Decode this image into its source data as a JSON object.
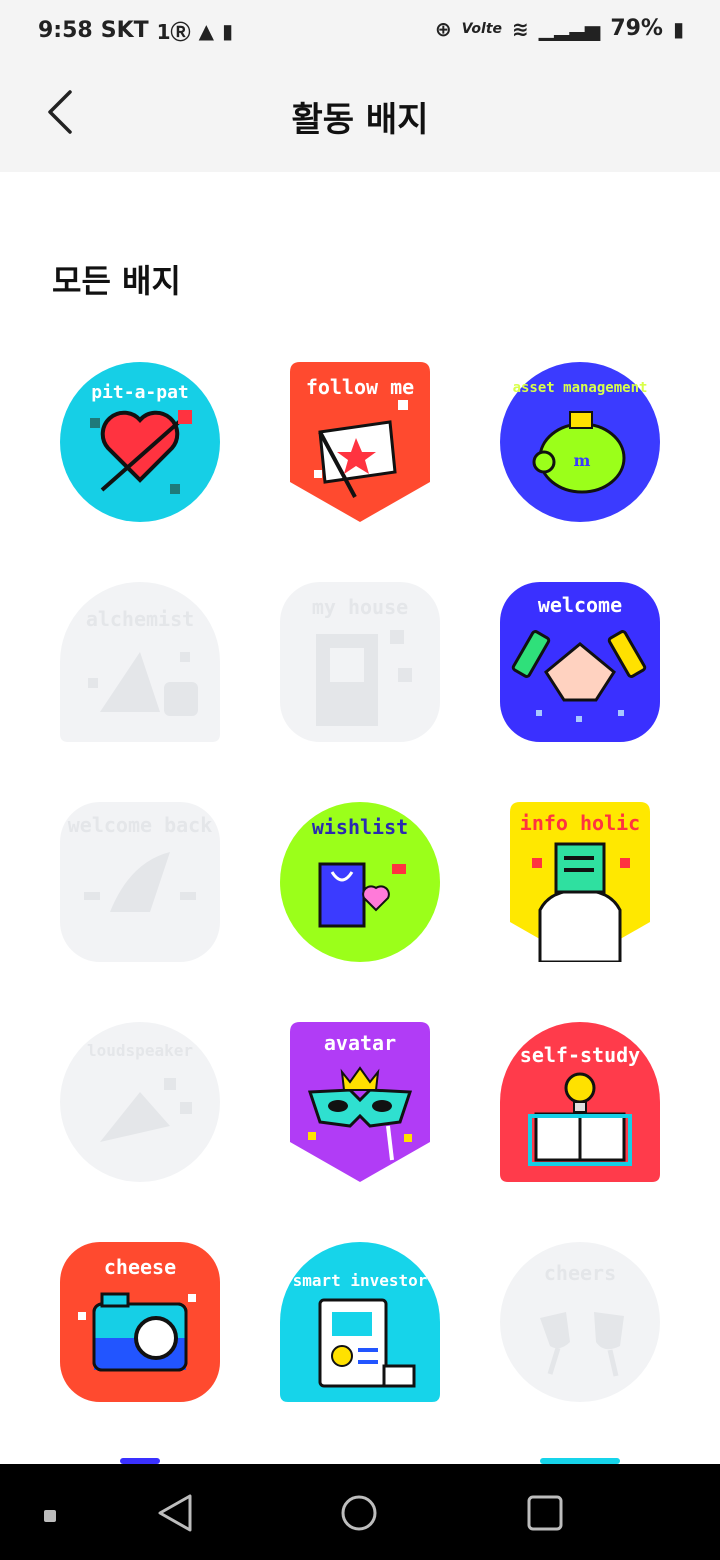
{
  "status_bar": {
    "time": "9:58",
    "carrier": "SKT",
    "network": "Volte",
    "battery": "79%"
  },
  "header": {
    "title": "활동 배지"
  },
  "section": {
    "title": "모든 배지"
  },
  "badges": [
    {
      "label": "pit-a-pat",
      "shape": "circle",
      "color": "#16cfe6",
      "unlocked": true
    },
    {
      "label": "follow me",
      "shape": "shield",
      "color": "#ff4a2f",
      "unlocked": true
    },
    {
      "label": "asset management",
      "shape": "circle",
      "color": "#3b3bff",
      "unlocked": true
    },
    {
      "label": "alchemist",
      "shape": "arch",
      "color": "#f2f3f5",
      "unlocked": false
    },
    {
      "label": "my house",
      "shape": "rounded",
      "color": "#f2f3f5",
      "unlocked": false
    },
    {
      "label": "welcome",
      "shape": "rounded",
      "color": "#3a30ff",
      "unlocked": true
    },
    {
      "label": "welcome back",
      "shape": "rounded",
      "color": "#f2f3f5",
      "unlocked": false
    },
    {
      "label": "wishlist",
      "shape": "circle",
      "color": "#9bff1a",
      "unlocked": true
    },
    {
      "label": "info holic",
      "shape": "shield",
      "color": "#ffe800",
      "unlocked": true
    },
    {
      "label": "loudspeaker",
      "shape": "circle",
      "color": "#f2f3f5",
      "unlocked": false
    },
    {
      "label": "avatar",
      "shape": "shield",
      "color": "#b13cf6",
      "unlocked": true
    },
    {
      "label": "self-study",
      "shape": "arch",
      "color": "#ff3b4b",
      "unlocked": true
    },
    {
      "label": "cheese",
      "shape": "rounded",
      "color": "#ff4a2f",
      "unlocked": true
    },
    {
      "label": "smart investor",
      "shape": "arch",
      "color": "#16d4ea",
      "unlocked": true
    },
    {
      "label": "cheers",
      "shape": "circle",
      "color": "#f2f3f5",
      "unlocked": false
    }
  ],
  "icons": {
    "back": "back-arrow-icon",
    "nav_recent": "square-icon",
    "nav_home": "circle-icon",
    "nav_back": "triangle-back-icon"
  }
}
